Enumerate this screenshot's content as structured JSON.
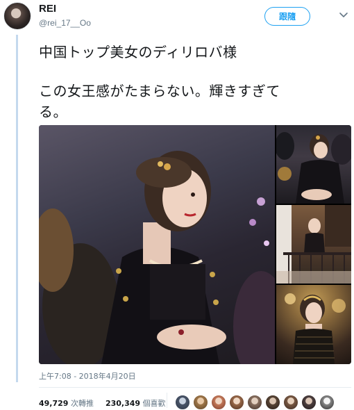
{
  "user": {
    "display_name": "REI",
    "handle": "@rei_17__Oo"
  },
  "follow_button": {
    "label": "跟隨"
  },
  "tweet": {
    "lines": [
      "中国トップ美女のディリロバ様",
      "この女王感がたまらない。輝きすぎて",
      "る。"
    ]
  },
  "timestamp": "上午7:08 - 2018年4月20日",
  "stats": {
    "retweets_count": "49,729",
    "retweets_label": "次轉推",
    "likes_count": "230,349",
    "likes_label": "個喜歡"
  },
  "icons": {
    "menu": "chevron-down-icon"
  },
  "colors": {
    "accent": "#1da1f2",
    "thread_line": "#c4d9ee",
    "secondary_text": "#657786"
  }
}
